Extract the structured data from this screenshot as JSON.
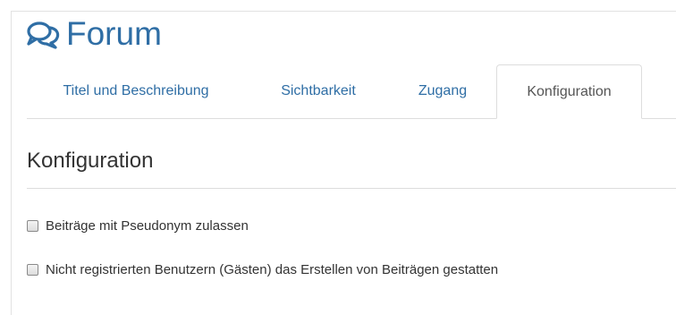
{
  "header": {
    "icon": "chat-bubbles-icon",
    "title": "Forum"
  },
  "tabs": [
    {
      "label": "Titel und Beschreibung",
      "active": false
    },
    {
      "label": "Sichtbarkeit",
      "active": false
    },
    {
      "label": "Zugang",
      "active": false
    },
    {
      "label": "Konfiguration",
      "active": true
    }
  ],
  "section": {
    "title": "Konfiguration",
    "options": [
      {
        "label": "Beiträge mit Pseudonym zulassen",
        "checked": false
      },
      {
        "label": "Nicht registrierten Benutzern (Gästen) das Erstellen von Beiträgen gestatten",
        "checked": false
      }
    ]
  },
  "colors": {
    "accent": "#2f6ea5",
    "text": "#333333",
    "border": "#dddddd"
  }
}
